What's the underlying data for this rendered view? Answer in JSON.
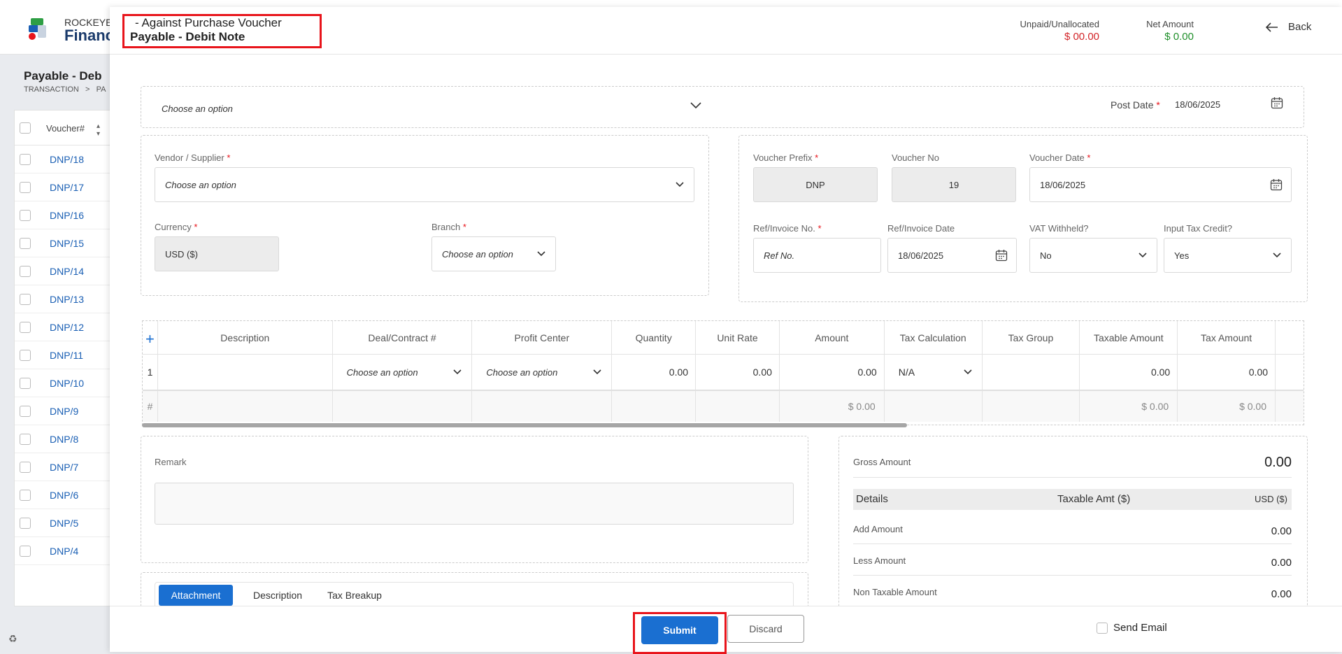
{
  "background": {
    "brand_line1": "ROCKEYE",
    "brand_line2": "Financ",
    "page_title": "Payable - Deb",
    "breadcrumb": "TRANSACTION   >   PA",
    "list_header": "Voucher#",
    "vouchers": [
      "DNP/18",
      "DNP/17",
      "DNP/16",
      "DNP/15",
      "DNP/14",
      "DNP/13",
      "DNP/12",
      "DNP/11",
      "DNP/10",
      "DNP/9",
      "DNP/8",
      "DNP/7",
      "DNP/6",
      "DNP/5",
      "DNP/4"
    ]
  },
  "header": {
    "title_line1": "- Against Purchase Voucher",
    "title_line2": "Payable - Debit Note",
    "unpaid_label": "Unpaid/Unallocated",
    "unpaid_value": "$ 00.00",
    "net_label": "Net Amount",
    "net_value": "$ 0.00",
    "back_label": "Back"
  },
  "top": {
    "option_placeholder": "Choose an option",
    "post_date_label": "Post Date",
    "post_date_value": "18/06/2025"
  },
  "left_form": {
    "vendor_label": "Vendor / Supplier",
    "vendor_placeholder": "Choose an option",
    "currency_label": "Currency",
    "currency_value": "USD ($)",
    "branch_label": "Branch",
    "branch_placeholder": "Choose an option"
  },
  "right_form": {
    "prefix_label": "Voucher Prefix",
    "prefix_value": "DNP",
    "voucher_no_label": "Voucher No",
    "voucher_no_value": "19",
    "voucher_date_label": "Voucher Date",
    "voucher_date_value": "18/06/2025",
    "ref_label": "Ref/Invoice No.",
    "ref_placeholder": "Ref No.",
    "ref_date_label": "Ref/Invoice Date",
    "ref_date_value": "18/06/2025",
    "vat_label": "VAT Withheld?",
    "vat_value": "No",
    "itc_label": "Input Tax Credit?",
    "itc_value": "Yes"
  },
  "grid": {
    "add_icon": "+",
    "columns": [
      "Description",
      "Deal/Contract #",
      "Profit Center",
      "Quantity",
      "Unit Rate",
      "Amount",
      "Tax Calculation",
      "Tax Group",
      "Taxable Amount",
      "Tax Amount"
    ],
    "row": {
      "index": "1",
      "deal_placeholder": "Choose an option",
      "profit_placeholder": "Choose an option",
      "quantity": "0.00",
      "unit_rate": "0.00",
      "amount": "0.00",
      "tax_calc": "N/A",
      "taxable_amount": "0.00",
      "tax_amount": "0.00"
    },
    "footer": {
      "hash": "#",
      "amount_total": "$ 0.00",
      "taxable_total": "$ 0.00",
      "tax_total": "$ 0.00"
    }
  },
  "remark": {
    "label": "Remark"
  },
  "tabs": [
    "Attachment",
    "Description",
    "Tax Breakup"
  ],
  "summary": {
    "gross_label": "Gross Amount",
    "gross_value": "0.00",
    "details_label": "Details",
    "taxable_amt_label": "Taxable Amt ($)",
    "currency_label": "USD ($)",
    "add_label": "Add Amount",
    "add_value": "0.00",
    "less_label": "Less Amount",
    "less_value": "0.00",
    "nontax_label": "Non Taxable Amount",
    "nontax_value": "0.00"
  },
  "footer": {
    "submit_label": "Submit",
    "discard_label": "Discard",
    "send_email_label": "Send Email"
  },
  "colors": {
    "accent": "#1a6fd1",
    "unpaid": "#d3262a",
    "net": "#1f8f2a",
    "highlight": "#e8141b"
  }
}
